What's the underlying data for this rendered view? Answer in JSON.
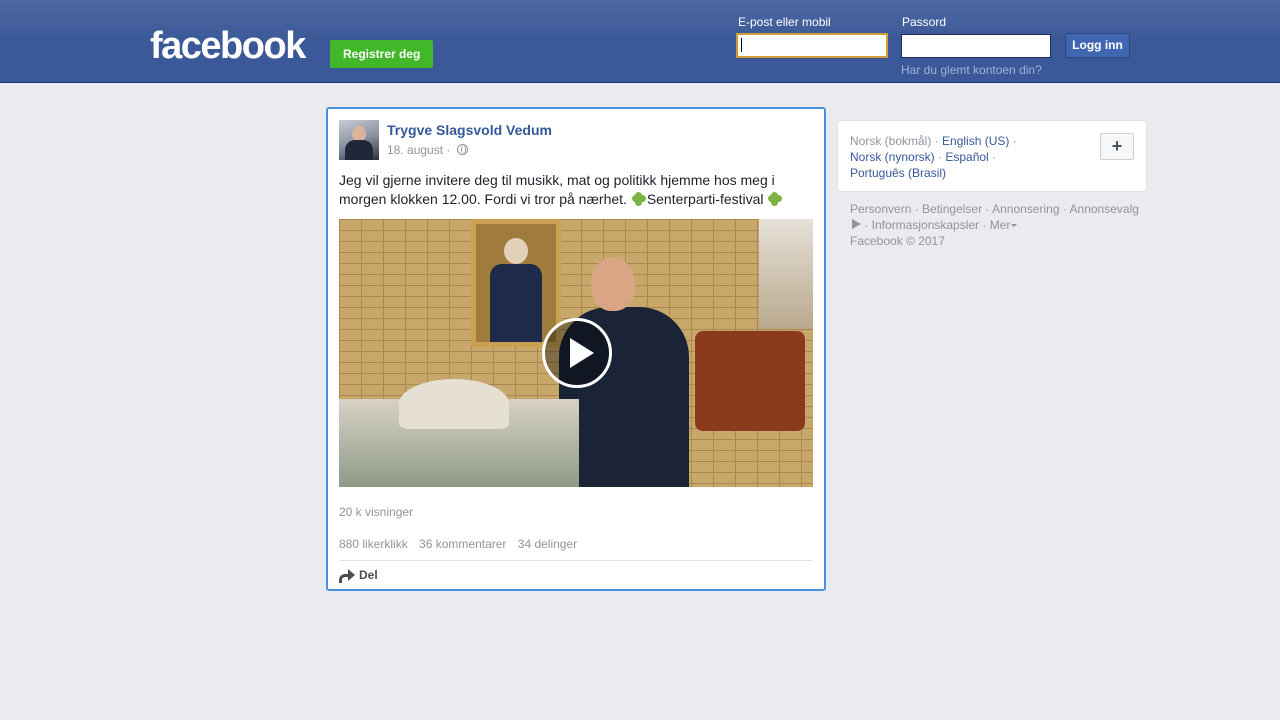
{
  "header": {
    "logo": "facebook",
    "register_label": "Registrer deg",
    "email_label": "E-post eller mobil",
    "password_label": "Passord",
    "login_label": "Logg inn",
    "forgot_label": "Har du glemt kontoen din?"
  },
  "post": {
    "author": "Trygve Slagsvold Vedum",
    "date": "18. august ·",
    "text_part1": "Jeg vil gjerne invitere deg til musikk, mat og politikk hjemme hos meg i morgen klokken 12.00. Fordi vi tror på nærhet.",
    "text_part2": "Senterparti-festival",
    "views": "20 k visninger",
    "likes": "880 likerklikk",
    "comments": "36 kommentarer",
    "shares": "34 delinger",
    "share_label": "Del"
  },
  "languages": {
    "current": "Norsk (bokmål)",
    "options": [
      "English (US)",
      "Norsk (nynorsk)",
      "Español",
      "Português (Brasil)"
    ],
    "add_label": "+"
  },
  "footer": {
    "privacy": "Personvern",
    "terms": "Betingelser",
    "advertising": "Annonsering",
    "ad_choices": "Annonsevalg",
    "cookies": "Informasjonskapsler",
    "more": "Mer",
    "copyright": "Facebook © 2017"
  },
  "colors": {
    "brand": "#3b5998",
    "register_green": "#42b72a",
    "link": "#365899"
  }
}
